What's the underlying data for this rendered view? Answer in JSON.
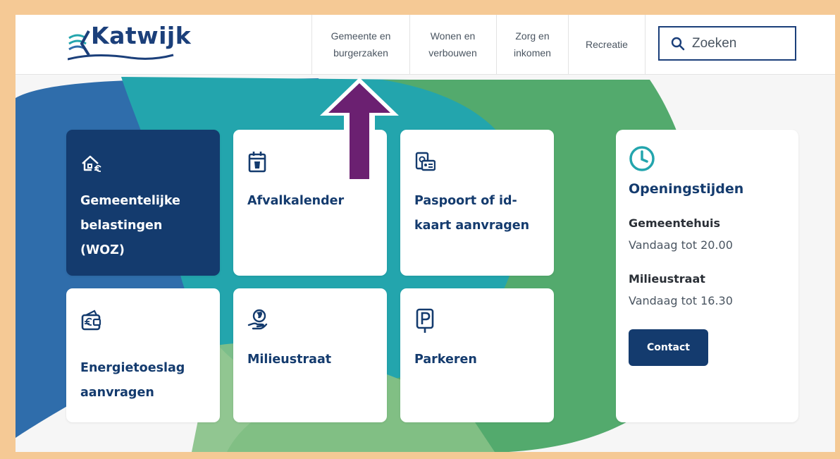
{
  "brand": {
    "name": "Katwijk",
    "color": "#143b6e"
  },
  "nav": [
    {
      "label": "Gemeente en\nburgerzaken"
    },
    {
      "label": "Wonen en\nverbouwen"
    },
    {
      "label": "Zorg en\ninkomen"
    },
    {
      "label": "Recreatie"
    }
  ],
  "search": {
    "placeholder": "Zoeken",
    "icon": "search-icon"
  },
  "tiles": [
    {
      "label": "Gemeentelijke belastingen (WOZ)",
      "icon": "house-euro-icon",
      "active": true
    },
    {
      "label": "Afvalkalender",
      "icon": "calendar-bin-icon"
    },
    {
      "label": "Paspoort of id-kaart aanvragen",
      "icon": "passport-id-icon"
    },
    {
      "label": "Energietoeslag aanvragen",
      "icon": "wallet-euro-icon"
    },
    {
      "label": "Milieustraat",
      "icon": "hand-globe-icon"
    },
    {
      "label": "Parkeren",
      "icon": "parking-sign-icon"
    }
  ],
  "hours": {
    "title": "Openingstijden",
    "icon": "clock-icon",
    "locations": [
      {
        "name": "Gemeentehuis",
        "time": "Vandaag tot 20.00"
      },
      {
        "name": "Milieustraat",
        "time": "Vandaag tot 16.30"
      }
    ],
    "contact_label": "Contact"
  },
  "annotation": {
    "arrow_color": "#6b2071"
  }
}
